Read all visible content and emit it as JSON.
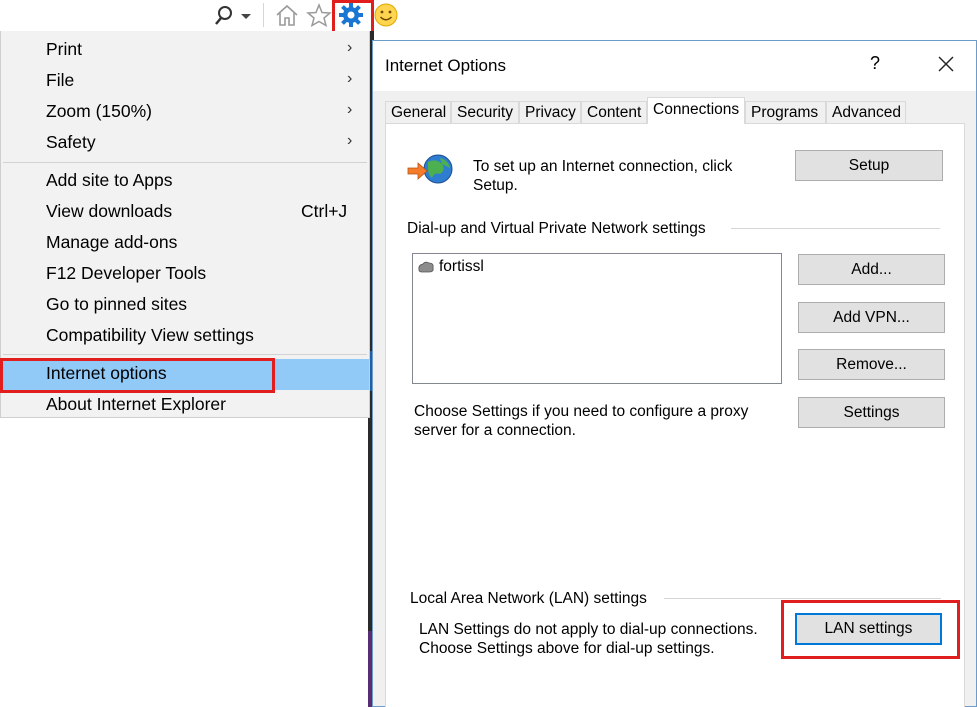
{
  "toolbar": {
    "icons": [
      "search-icon",
      "chevron-down-icon",
      "home-icon",
      "favorites-star-icon",
      "tools-gear-icon",
      "feedback-smiley-icon"
    ],
    "gear_color": "#1976d2"
  },
  "menu": {
    "items": [
      {
        "label": "Print",
        "submenu": true
      },
      {
        "label": "File",
        "submenu": true
      },
      {
        "label": "Zoom (150%)",
        "submenu": true
      },
      {
        "label": "Safety",
        "submenu": true
      },
      {
        "label": "Add site to Apps"
      },
      {
        "label": "View downloads",
        "shortcut": "Ctrl+J"
      },
      {
        "label": "Manage add-ons"
      },
      {
        "label": "F12 Developer Tools"
      },
      {
        "label": "Go to pinned sites"
      },
      {
        "label": "Compatibility View settings"
      },
      {
        "label": "Internet options",
        "selected": true
      },
      {
        "label": "About Internet Explorer"
      }
    ],
    "arrow_glyph": "›",
    "highlight_color": "#91c9f7"
  },
  "dialog": {
    "title": "Internet Options",
    "help_label": "?",
    "tabs": [
      "General",
      "Security",
      "Privacy",
      "Content",
      "Connections",
      "Programs",
      "Advanced"
    ],
    "active_tab": "Connections",
    "setup": {
      "text_line1": "To set up an Internet connection, click",
      "text_line2": "Setup.",
      "button": "Setup"
    },
    "dialup": {
      "group_label": "Dial-up and Virtual Private Network settings",
      "entries": [
        "fortissl"
      ],
      "add_button": "Add...",
      "add_vpn_button": "Add VPN...",
      "remove_button": "Remove...",
      "settings_text_line1": "Choose Settings if you need to configure a proxy",
      "settings_text_line2": "server for a connection.",
      "settings_button": "Settings"
    },
    "lan": {
      "group_label": "Local Area Network (LAN) settings",
      "text_line1": "LAN Settings do not apply to dial-up connections.",
      "text_line2": "Choose Settings above for dial-up settings.",
      "button": "LAN settings"
    }
  },
  "highlight_color": "#e01e1e"
}
